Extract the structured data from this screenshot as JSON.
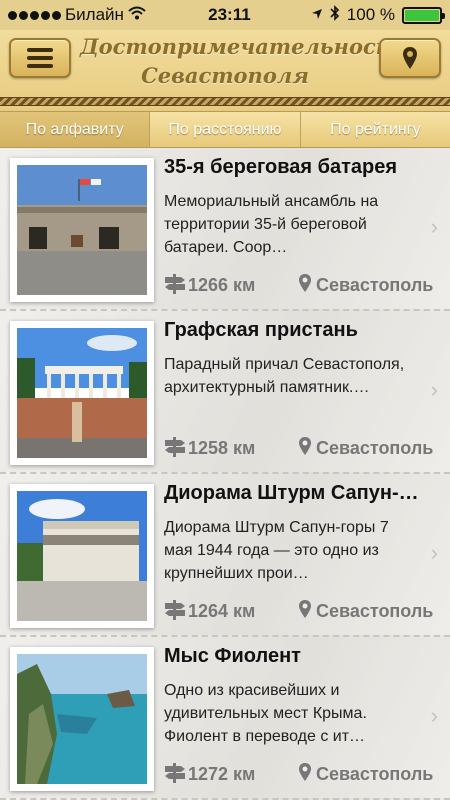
{
  "status_bar": {
    "carrier": "Билайн",
    "time": "23:11",
    "battery": "100 %",
    "battery_level": 1.0
  },
  "header": {
    "title_line1": "Достопримечательности",
    "title_line2": "Севастополя",
    "menu_icon": "hamburger-icon",
    "map_icon": "map-pin-icon"
  },
  "tabs": [
    {
      "label": "По алфавиту"
    },
    {
      "label": "По расстоянию"
    },
    {
      "label": "По рейтингу"
    }
  ],
  "places": [
    {
      "title": "35-я береговая батарея",
      "description": "Мемориальный ансамбль на территории 35-й береговой батареи. Соор…",
      "distance": "1266 км",
      "city": "Севастополь"
    },
    {
      "title": "Графская пристань",
      "description": "Парадный причал Севастополя, архитектурный памятник.…",
      "distance": "1258 км",
      "city": "Севастополь"
    },
    {
      "title": "Диорама Штурм Сапун-…",
      "description": "Диорама Штурм Сапун-горы 7 мая 1944 года — это одно из крупнейших прои…",
      "distance": "1264 км",
      "city": "Севастополь"
    },
    {
      "title": "Мыс Фиолент",
      "description": "Одно из красивейших и удивительных мест Крыма. Фиолент в переводе с ит…",
      "distance": "1272 км",
      "city": "Севастополь"
    }
  ],
  "colors": {
    "header_gold": "#e7cc80",
    "title_brown": "#8b6d2c",
    "meta_gray": "#777777"
  }
}
